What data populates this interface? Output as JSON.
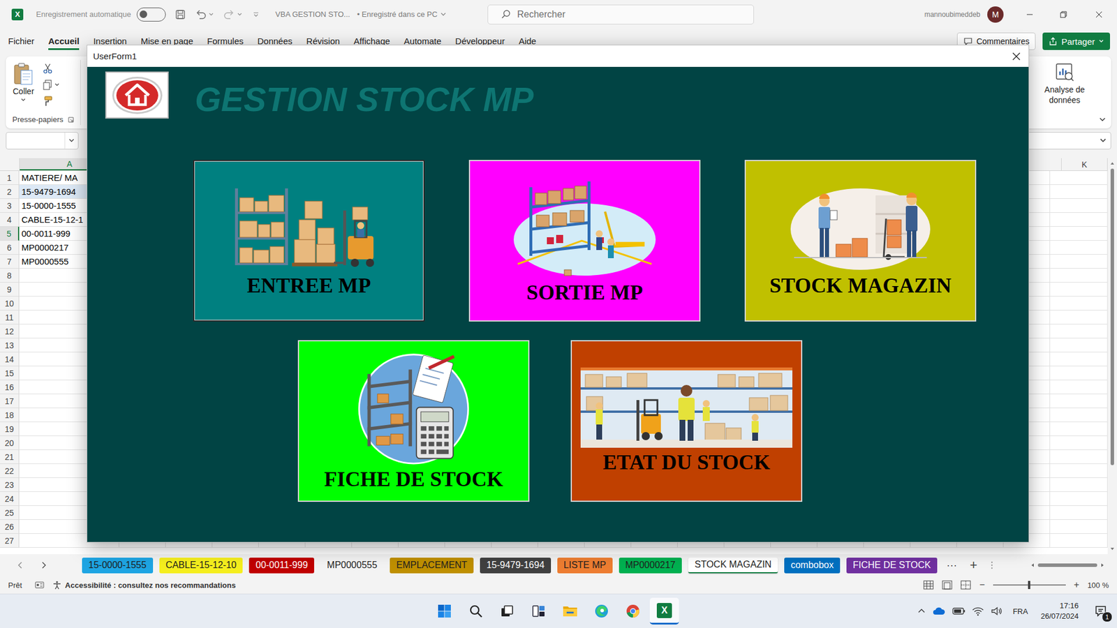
{
  "title_bar": {
    "app_logo": "X",
    "autosave_label": "Enregistrement automatique",
    "autosave_on": false,
    "file_name": "VBA GESTION STO...",
    "save_status": "• Enregistré dans ce PC",
    "search_placeholder": "Rechercher",
    "user_name": "mannoubimeddeb",
    "avatar_initial": "M"
  },
  "ribbon_tabs": [
    {
      "label": "Fichier",
      "selected": false
    },
    {
      "label": "Accueil",
      "selected": true
    },
    {
      "label": "Insertion",
      "selected": false
    },
    {
      "label": "Mise en page",
      "selected": false
    },
    {
      "label": "Formules",
      "selected": false
    },
    {
      "label": "Données",
      "selected": false
    },
    {
      "label": "Révision",
      "selected": false
    },
    {
      "label": "Affichage",
      "selected": false
    },
    {
      "label": "Automate",
      "selected": false
    },
    {
      "label": "Développeur",
      "selected": false
    },
    {
      "label": "Aide",
      "selected": false
    }
  ],
  "comments_button": "Commentaires",
  "share_button": "Partager",
  "ribbon": {
    "paste_label": "Coller",
    "clipboard_group": "Presse-papiers",
    "analysis_label": "Analyse de données"
  },
  "columns": [
    {
      "label": "A",
      "selected": true
    },
    {
      "label": "K",
      "selected": false
    }
  ],
  "rows": [
    {
      "number": "1",
      "cell_a": "MATIERE/ MA",
      "row_selected": false,
      "cell_highlighted": false
    },
    {
      "number": "2",
      "cell_a": "15-9479-1694",
      "row_selected": false,
      "cell_highlighted": true
    },
    {
      "number": "3",
      "cell_a": "15-0000-1555",
      "row_selected": false,
      "cell_highlighted": false
    },
    {
      "number": "4",
      "cell_a": "CABLE-15-12-1",
      "row_selected": false,
      "cell_highlighted": false
    },
    {
      "number": "5",
      "cell_a": "00-0011-999",
      "row_selected": true,
      "cell_highlighted": false
    },
    {
      "number": "6",
      "cell_a": "MP0000217",
      "row_selected": false,
      "cell_highlighted": false
    },
    {
      "number": "7",
      "cell_a": "MP0000555",
      "row_selected": false,
      "cell_highlighted": false
    },
    {
      "number": "8",
      "cell_a": "",
      "row_selected": false,
      "cell_highlighted": false
    },
    {
      "number": "9",
      "cell_a": "",
      "row_selected": false,
      "cell_highlighted": false
    },
    {
      "number": "10",
      "cell_a": "",
      "row_selected": false,
      "cell_highlighted": false
    },
    {
      "number": "11",
      "cell_a": "",
      "row_selected": false,
      "cell_highlighted": false
    },
    {
      "number": "12",
      "cell_a": "",
      "row_selected": false,
      "cell_highlighted": false
    },
    {
      "number": "13",
      "cell_a": "",
      "row_selected": false,
      "cell_highlighted": false
    },
    {
      "number": "14",
      "cell_a": "",
      "row_selected": false,
      "cell_highlighted": false
    },
    {
      "number": "15",
      "cell_a": "",
      "row_selected": false,
      "cell_highlighted": false
    },
    {
      "number": "16",
      "cell_a": "",
      "row_selected": false,
      "cell_highlighted": false
    },
    {
      "number": "17",
      "cell_a": "",
      "row_selected": false,
      "cell_highlighted": false
    },
    {
      "number": "18",
      "cell_a": "",
      "row_selected": false,
      "cell_highlighted": false
    },
    {
      "number": "19",
      "cell_a": "",
      "row_selected": false,
      "cell_highlighted": false
    },
    {
      "number": "20",
      "cell_a": "",
      "row_selected": false,
      "cell_highlighted": false
    },
    {
      "number": "21",
      "cell_a": "",
      "row_selected": false,
      "cell_highlighted": false
    },
    {
      "number": "22",
      "cell_a": "",
      "row_selected": false,
      "cell_highlighted": false
    },
    {
      "number": "23",
      "cell_a": "",
      "row_selected": false,
      "cell_highlighted": false
    },
    {
      "number": "24",
      "cell_a": "",
      "row_selected": false,
      "cell_highlighted": false
    },
    {
      "number": "25",
      "cell_a": "",
      "row_selected": false,
      "cell_highlighted": false
    },
    {
      "number": "26",
      "cell_a": "",
      "row_selected": false,
      "cell_highlighted": false
    },
    {
      "number": "27",
      "cell_a": "",
      "row_selected": false,
      "cell_highlighted": false
    }
  ],
  "sheet_tabs": [
    {
      "label": "15-0000-1555",
      "color": "#1ea5e3",
      "selected": false
    },
    {
      "label": "CABLE-15-12-10",
      "color": "#f5ee1e",
      "selected": false
    },
    {
      "label": "00-0011-999",
      "color": "#c00000",
      "selected": false
    },
    {
      "label": "MP0000555",
      "color": "#f3f3f3",
      "selected": false
    },
    {
      "label": "EMPLACEMENT",
      "color": "#bf8f00",
      "selected": false
    },
    {
      "label": "15-9479-1694",
      "color": "#404040",
      "selected": false
    },
    {
      "label": "LISTE MP",
      "color": "#ed7d31",
      "selected": false
    },
    {
      "label": "MP0000217",
      "color": "#00b050",
      "selected": false
    },
    {
      "label": "STOCK MAGAZIN",
      "color": "#ffffff",
      "selected": true
    },
    {
      "label": "combobox",
      "color": "#0070c0",
      "selected": false
    },
    {
      "label": "FICHE DE STOCK",
      "color": "#7030a0",
      "selected": false
    }
  ],
  "sheet_controls": {
    "more": "···",
    "add": "+"
  },
  "status_bar": {
    "ready": "Prêt",
    "accessibility": "Accessibilité : consultez nos recommandations",
    "zoom_out": "−",
    "zoom_in": "+",
    "zoom": "100 %",
    "zoom_level": 0.5
  },
  "userform": {
    "title": "UserForm1",
    "heading": "GESTION STOCK MP",
    "tiles": [
      {
        "label": "ENTREE MP",
        "kind": "entree",
        "color": "#008080",
        "focused": true
      },
      {
        "label": "SORTIE MP",
        "kind": "sortie",
        "color": "#ff00ff",
        "focused": false
      },
      {
        "label": "STOCK MAGAZIN",
        "kind": "magazin",
        "color": "#c0c000",
        "focused": false
      },
      {
        "label": "FICHE DE STOCK",
        "kind": "fiche",
        "color": "#00ff00",
        "focused": false
      },
      {
        "label": "ETAT DU STOCK",
        "kind": "etat",
        "color": "#c04000",
        "focused": false
      }
    ]
  },
  "taskbar": {
    "language": "FRA",
    "time": "17:16",
    "date": "26/07/2024",
    "notifications": "1"
  }
}
